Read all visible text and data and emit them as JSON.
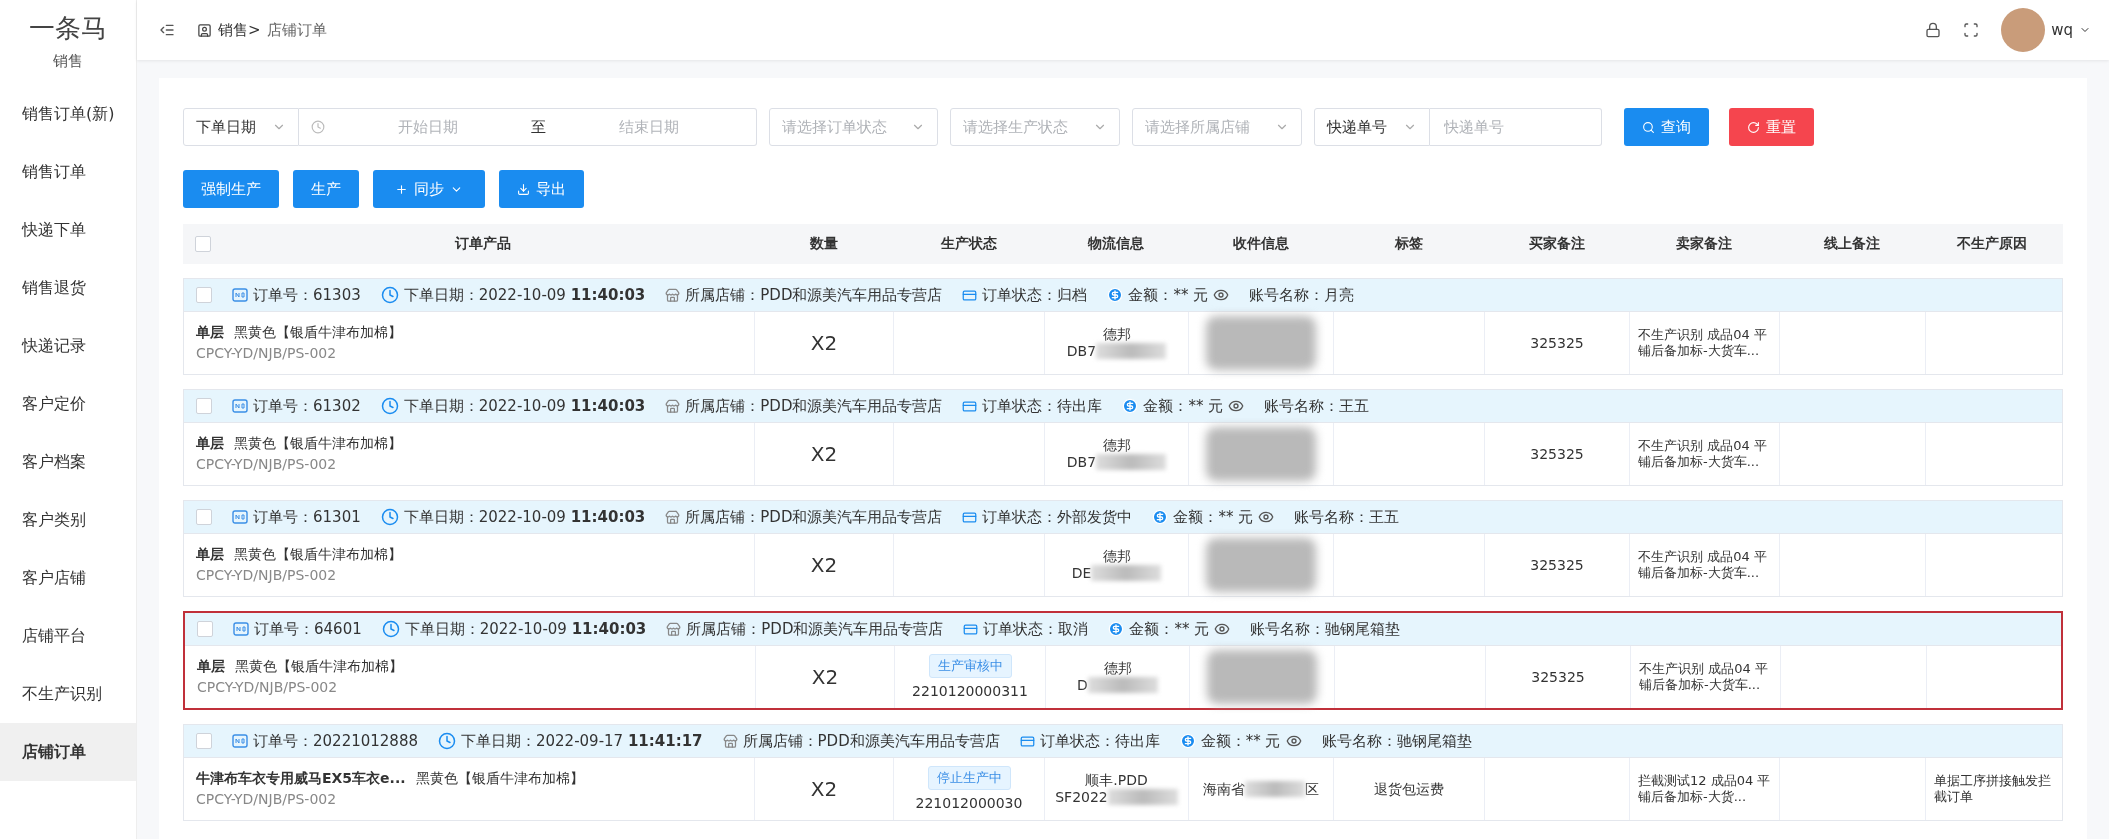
{
  "sidebar": {
    "logo": "一条马",
    "section": "销售",
    "items": [
      {
        "label": "销售订单(新)",
        "selected": false
      },
      {
        "label": "销售订单",
        "selected": false
      },
      {
        "label": "快递下单",
        "selected": false
      },
      {
        "label": "销售退货",
        "selected": false
      },
      {
        "label": "快递记录",
        "selected": false
      },
      {
        "label": "客户定价",
        "selected": false
      },
      {
        "label": "客户档案",
        "selected": false
      },
      {
        "label": "客户类别",
        "selected": false
      },
      {
        "label": "客户店铺",
        "selected": false
      },
      {
        "label": "店铺平台",
        "selected": false
      },
      {
        "label": "不生产识别",
        "selected": false
      },
      {
        "label": "店铺订单",
        "selected": true
      }
    ]
  },
  "header": {
    "breadcrumb": [
      "销售>",
      "店铺订单"
    ],
    "user": "wq"
  },
  "filters": {
    "date_type": "下单日期",
    "start_placeholder": "开始日期",
    "range_separator": "至",
    "end_placeholder": "结束日期",
    "selects": [
      "请选择订单状态",
      "请选择生产状态",
      "请选择所属店铺"
    ],
    "express_type": "快递单号",
    "express_placeholder": "快递单号",
    "query": "查询",
    "reset": "重置"
  },
  "actions": [
    {
      "label": "强制生产",
      "kind": "plain"
    },
    {
      "label": "生产",
      "kind": "plain"
    },
    {
      "label": "同步",
      "kind": "sync"
    },
    {
      "label": "导出",
      "kind": "export"
    }
  ],
  "table": {
    "select_all_checked": false,
    "columns": [
      "订单产品",
      "数量",
      "生产状态",
      "物流信息",
      "收件信息",
      "标签",
      "买家备注",
      "卖家备注",
      "线上备注",
      "不生产原因"
    ],
    "orders": [
      {
        "checked": false,
        "highlighted": false,
        "order_no": "订单号：61303",
        "date": "下单日期：2022-10-09 **11:40:03**",
        "store": "所属店铺：PDD和源美汽车用品专营店",
        "status": "订单状态：归档",
        "amount": "金额：** 元",
        "account": "账号名称：月亮",
        "product": "单层",
        "spec": "黑黄色【银盾牛津布加棉】",
        "sku": "CPCY-YD/NJB/PS-002",
        "qty": "X2",
        "carrier": "德邦",
        "tracking": "DB7",
        "buyer_note": "325325",
        "seller_note": "不生产识别 成品04 平铺后备加标-大货车..."
      },
      {
        "checked": false,
        "highlighted": false,
        "order_no": "订单号：61302",
        "date": "下单日期：2022-10-09 **11:40:03**",
        "store": "所属店铺：PDD和源美汽车用品专营店",
        "status": "订单状态：待出库",
        "amount": "金额：** 元",
        "account": "账号名称：王五",
        "product": "单层",
        "spec": "黑黄色【银盾牛津布加棉】",
        "sku": "CPCY-YD/NJB/PS-002",
        "qty": "X2",
        "carrier": "德邦",
        "tracking": "DB7",
        "buyer_note": "325325",
        "seller_note": "不生产识别 成品04 平铺后备加标-大货车..."
      },
      {
        "checked": false,
        "highlighted": false,
        "order_no": "订单号：61301",
        "date": "下单日期：2022-10-09 **11:40:03**",
        "store": "所属店铺：PDD和源美汽车用品专营店",
        "status": "订单状态：外部发货中",
        "amount": "金额：** 元",
        "account": "账号名称：王五",
        "product": "单层",
        "spec": "黑黄色【银盾牛津布加棉】",
        "sku": "CPCY-YD/NJB/PS-002",
        "qty": "X2",
        "carrier": "德邦",
        "tracking": "DE",
        "buyer_note": "325325",
        "seller_note": "不生产识别 成品04 平铺后备加标-大货车..."
      },
      {
        "checked": false,
        "highlighted": true,
        "order_no": "订单号：64601",
        "date": "下单日期：2022-10-09 **11:40:03**",
        "store": "所属店铺：PDD和源美汽车用品专营店",
        "status": "订单状态：取消",
        "amount": "金额：** 元",
        "account": "账号名称：驰钢尾箱垫",
        "product": "单层",
        "spec": "黑黄色【银盾牛津布加棉】",
        "sku": "CPCY-YD/NJB/PS-002",
        "qty": "X2",
        "production": {
          "label": "生产审核中",
          "code": "2210120000311"
        },
        "carrier": "德邦",
        "tracking": "D",
        "buyer_note": "325325",
        "seller_note": "不生产识别 成品04 平铺后备加标-大货车..."
      },
      {
        "checked": false,
        "highlighted": false,
        "order_no": "订单号：20221012888",
        "date": "下单日期：2022-09-17 **11:41:17**",
        "store": "所属店铺：PDD和源美汽车用品专营店",
        "status": "订单状态：待出库",
        "amount": "金额：** 元",
        "account": "账号名称：驰钢尾箱垫",
        "product": "牛津布车衣专用威马EX5车衣e...",
        "spec": "黑黄色【银盾牛津布加棉】",
        "sku": "CPCY-YD/NJB/PS-002",
        "qty": "X2",
        "production": {
          "label": "停止生产中",
          "code": "221012000030"
        },
        "carrier": "顺丰.PDD",
        "tracking": "SF2022",
        "receiver": {
          "start": "海南省",
          "end": "区"
        },
        "tag": "退货包运费",
        "seller_note": "拦截测试12 成品04 平铺后备加标-大货...",
        "reason": "单据工序拼接触发拦截订单"
      }
    ]
  }
}
